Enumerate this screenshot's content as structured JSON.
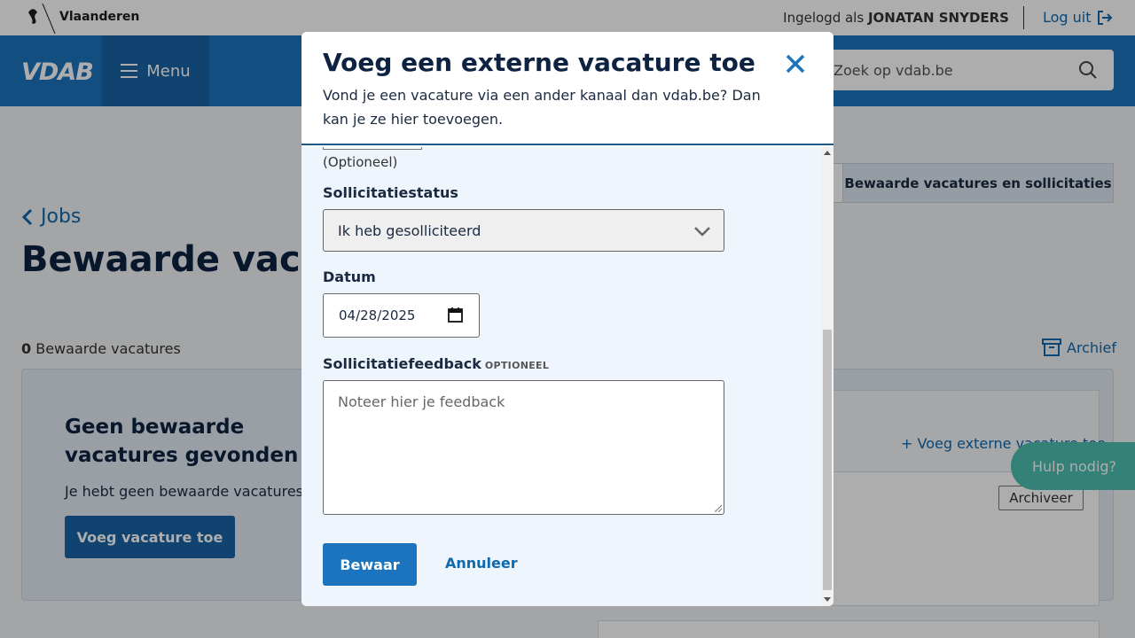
{
  "topbar": {
    "brand": "Vlaanderen",
    "logged_in_prefix": "Ingelogd als ",
    "user_name": "JONATAN SNYDERS",
    "logout_label": "Log uit"
  },
  "header": {
    "logo": "VDAB",
    "menu_label": "Menu",
    "search_placeholder": "Zoek op vdab.be"
  },
  "page": {
    "back_label": "Jobs",
    "title": "Bewaarde vacatures",
    "tab_label": "Bewaarde vacatures en sollicitaties",
    "count": "0",
    "count_label": " Bewaarde vacatures",
    "archive_label": "Archief",
    "empty_title": "Geen bewaarde vacatures gevonden",
    "empty_text": "Je hebt geen bewaarde vacatures.",
    "add_button": "Voeg vacature toe",
    "side_add_label": "Voeg externe vacature toe",
    "archiveer_label": "Archiveer",
    "help_label": "Hulp nodig?"
  },
  "modal": {
    "title": "Voeg een externe vacature toe",
    "subtitle": "Vond je een vacature via een ander kanaal dan vdab.be? Dan kan je ze hier toevoegen.",
    "optional_note": "(Optioneel)",
    "status_label": "Sollicitatiestatus",
    "status_value": "Ik heb gesolliciteerd",
    "date_label": "Datum",
    "date_value": "04/28/2025",
    "feedback_label": "Sollicitatiefeedback",
    "feedback_optional": "OPTIONEEL",
    "feedback_placeholder": "Noteer hier je feedback",
    "save_label": "Bewaar",
    "cancel_label": "Annuleer"
  },
  "colors": {
    "primary": "#1c74bf",
    "navy": "#0d2341",
    "link": "#0f69af",
    "help": "#4dbfb0"
  }
}
